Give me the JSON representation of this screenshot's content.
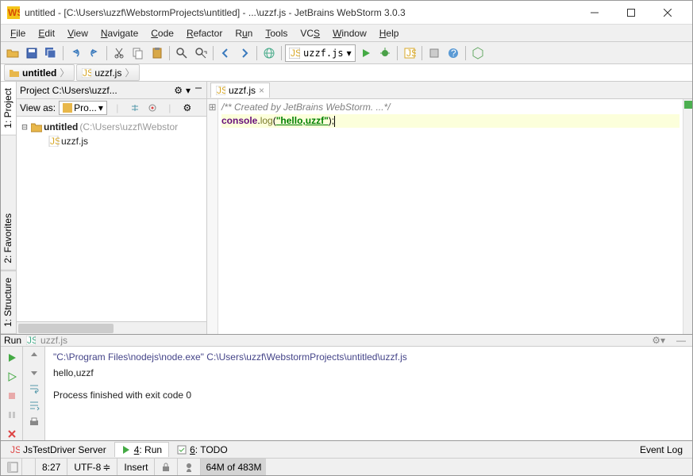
{
  "title": "untitled - [C:\\Users\\uzzf\\WebstormProjects\\untitled] - ...\\uzzf.js - JetBrains WebStorm 3.0.3",
  "menu": {
    "file": "File",
    "edit": "Edit",
    "view": "View",
    "navigate": "Navigate",
    "code": "Code",
    "refactor": "Refactor",
    "run": "Run",
    "tools": "Tools",
    "vcs": "VCS",
    "window": "Window",
    "help": "Help"
  },
  "toolbar": {
    "run_config": "uzzf.js"
  },
  "breadcrumb": {
    "project": "untitled",
    "file": "uzzf.js"
  },
  "project_panel": {
    "title": "Project C:\\Users\\uzzf...",
    "view_as": "View as:",
    "view_mode": "Pro...",
    "tree": {
      "root": "untitled",
      "root_loc": "(C:\\Users\\uzzf\\Webstor",
      "file": "uzzf.js"
    }
  },
  "side_tabs": {
    "project": "1: Project",
    "favorites": "2: Favorites",
    "structure": "1: Structure"
  },
  "editor": {
    "tab": "uzzf.js",
    "line1": "/** Created by JetBrains WebStorm. ...*/",
    "line2_a": "console",
    "line2_b": ".",
    "line2_c": "log",
    "line2_d": "(",
    "line2_e": "\"hello,uzzf\"",
    "line2_f": ");"
  },
  "run_panel": {
    "header": "Run",
    "header_file": "uzzf.js",
    "cmd": "\"C:\\Program Files\\nodejs\\node.exe\" C:\\Users\\uzzf\\WebstormProjects\\untitled\\uzzf.js",
    "out": "hello,uzzf",
    "done": "Process finished with exit code 0"
  },
  "bottom_tabs": {
    "jstest": "JsTestDriver Server",
    "run": "4: Run",
    "todo": "6: TODO",
    "event_log": "Event Log"
  },
  "status": {
    "pos": "8:27",
    "encoding": "UTF-8",
    "insert": "Insert",
    "mem": "64M of 483M"
  }
}
